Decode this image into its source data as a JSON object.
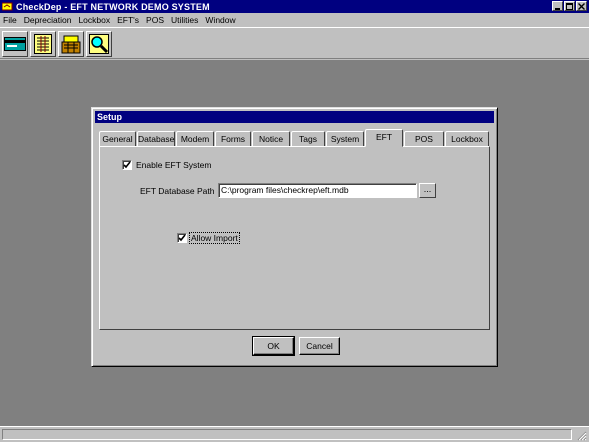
{
  "app": {
    "title": "CheckDep - EFT NETWORK DEMO SYSTEM"
  },
  "menu": [
    "File",
    "Depreciation",
    "Lockbox",
    "EFT's",
    "POS",
    "Utilities",
    "Window"
  ],
  "toolbar": {
    "buttons": [
      "card-icon",
      "ledger-icon",
      "cash-register-icon",
      "magnifier-icon"
    ]
  },
  "dialog": {
    "title": "Setup",
    "tabs": [
      "General",
      "Database",
      "Modem",
      "Forms",
      "Notice",
      "Tags",
      "System",
      "EFT",
      "POS",
      "Lockbox"
    ],
    "active_tab": "EFT",
    "enable_eft": {
      "label": "Enable EFT System",
      "checked": true
    },
    "db_path": {
      "label": "EFT Database Path",
      "value": "C:\\program files\\checkrep\\eft.mdb",
      "browse_label": "..."
    },
    "allow_import": {
      "label": "Allow Import",
      "checked": true
    },
    "ok_label": "OK",
    "cancel_label": "Cancel"
  },
  "colors": {
    "titlebar": "#000080",
    "workspace": "#808080",
    "face": "#c0c0c0"
  }
}
